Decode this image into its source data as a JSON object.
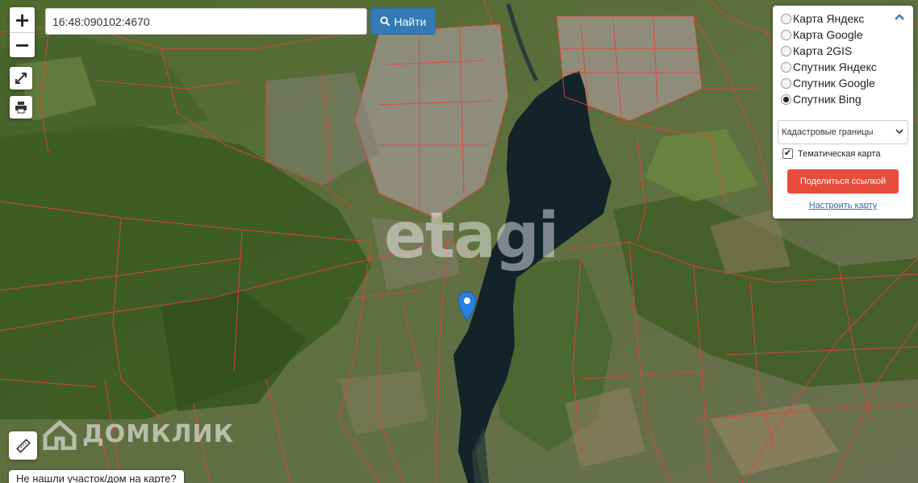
{
  "search": {
    "value": "16:48:090102:4670",
    "button_label": "Найти"
  },
  "zoom": {
    "in_label": "+",
    "out_label": "−"
  },
  "layers": {
    "options": [
      {
        "label": "Карта Яндекс",
        "checked": false
      },
      {
        "label": "Карта Google",
        "checked": false
      },
      {
        "label": "Карта 2GIS",
        "checked": false
      },
      {
        "label": "Спутник Яндекс",
        "checked": false
      },
      {
        "label": "Спутник Google",
        "checked": false
      },
      {
        "label": "Спутник Bing",
        "checked": true
      }
    ],
    "select_value": "Кадастровые границы",
    "thematic_label": "Тематическая карта",
    "share_label": "Поделиться ссылкой",
    "configure_label": "Настроить карту"
  },
  "not_found_label": "Не нашли участок/дом на карте?",
  "watermarks": {
    "etagi": "etagi",
    "domclick": "ДОМКЛИК"
  },
  "colors": {
    "accent": "#337ab7",
    "share": "#e74c3c",
    "boundary": "#e8413c",
    "water": "#13232a"
  },
  "icons": [
    "search-icon",
    "expand-icon",
    "print-icon",
    "ruler-icon",
    "chevron-up-icon",
    "chevron-down-icon",
    "map-marker-icon"
  ]
}
